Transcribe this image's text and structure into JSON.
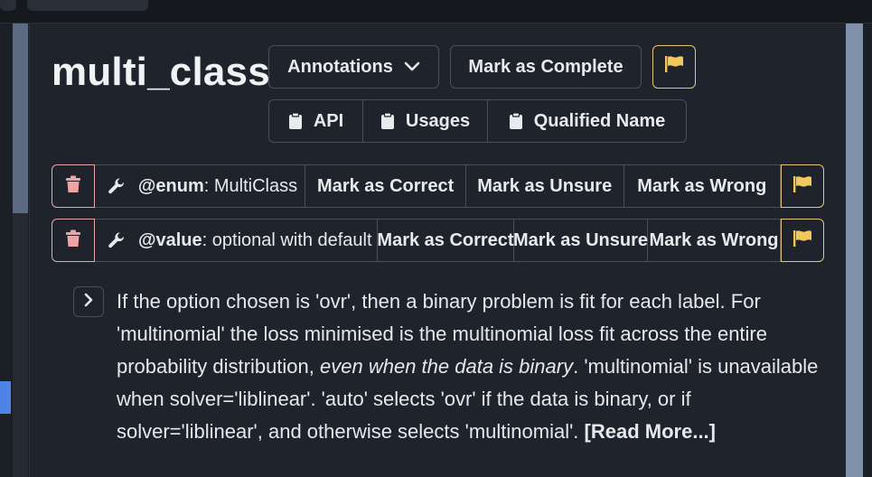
{
  "page": {
    "title": "multi_class"
  },
  "header_buttons": {
    "annotations": "Annotations",
    "mark_complete": "Mark as Complete"
  },
  "sub_buttons": {
    "api": "API",
    "usages": "Usages",
    "qualified_name": "Qualified Name"
  },
  "annotations": [
    {
      "kind": "@enum",
      "value": ": MultiClass",
      "actions": [
        "Mark as Correct",
        "Mark as Unsure",
        "Mark as Wrong"
      ]
    },
    {
      "kind": "@value",
      "value": ": optional with default 'auto'",
      "actions": [
        "Mark as Correct",
        "Mark as Unsure",
        "Mark as Wrong"
      ]
    }
  ],
  "description": {
    "part1": "If the option chosen is 'ovr', then a binary problem is fit for each label. For 'multinomial' the loss minimised is the multinomial loss fit across the entire probability distribution, ",
    "emphasis": "even when the data is binary",
    "part2": ". 'multinomial' is unavailable when solver='liblinear'. 'auto' selects 'ovr' if the data is binary, or if solver='liblinear', and otherwise selects 'multinomial'. ",
    "read_more": "[Read More...]"
  },
  "colors": {
    "background": "#1f232b",
    "border": "#4a505b",
    "delete_accent": "#e8a7a7",
    "flag_accent": "#e6c47a",
    "text": "#e6e8eb"
  },
  "icons": {
    "annotations_dropdown": "chevron-down-icon",
    "flag": "flag-icon",
    "clipboard": "clipboard-icon",
    "delete": "trash-icon",
    "wrench": "wrench-icon",
    "expand": "chevron-right-icon"
  }
}
